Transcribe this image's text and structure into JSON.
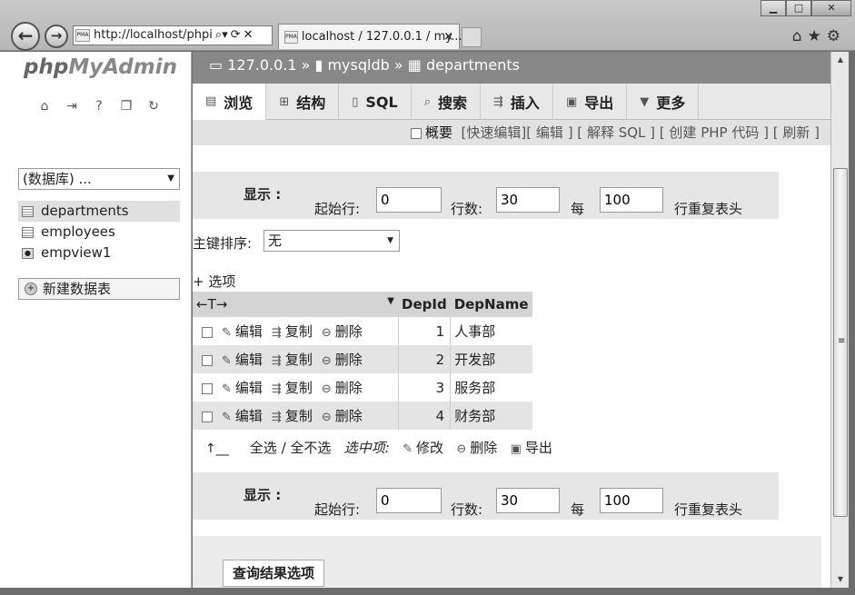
{
  "browser": {
    "address": "http://localhost/phpi",
    "tab_title": "localhost / 127.0.0.1 / my...",
    "tab_icon_label": "PMA",
    "tab_close": "×"
  },
  "sidebar": {
    "logo_php": "php",
    "logo_my": "MyAdmin",
    "db_select": "(数据库) ...",
    "tables": [
      {
        "label": "departments"
      },
      {
        "label": "employees"
      },
      {
        "label": "empview1"
      }
    ],
    "new_table": "新建数据表"
  },
  "breadcrumb": {
    "server": "127.0.0.1",
    "database": "mysqldb",
    "table": "departments",
    "sep": "»"
  },
  "tabs": [
    {
      "label": "浏览"
    },
    {
      "label": "结构"
    },
    {
      "label": "SQL"
    },
    {
      "label": "搜索"
    },
    {
      "label": "插入"
    },
    {
      "label": "导出"
    },
    {
      "label": "更多"
    }
  ],
  "links": {
    "profiling": "概要",
    "inline_edit": "快速编辑",
    "edit": "编辑",
    "explain": "解释 SQL",
    "create_php": "创建 PHP 代码",
    "refresh": "刷新"
  },
  "navigation": {
    "show_label": "显示 :",
    "start_row_label": "起始行:",
    "start_row": "0",
    "rows_label": "行数:",
    "rows": "30",
    "every_label": "每",
    "repeat": "100",
    "repeat_label": "行重复表头"
  },
  "sort": {
    "label": "主键排序:",
    "value": "无"
  },
  "options_label": "+ 选项",
  "table": {
    "arrows_header": "←T→",
    "columns": [
      "DepId",
      "DepName"
    ],
    "actions": {
      "edit": "编辑",
      "copy": "复制",
      "delete": "删除"
    },
    "rows": [
      {
        "id": "1",
        "name": "人事部"
      },
      {
        "id": "2",
        "name": "开发部"
      },
      {
        "id": "3",
        "name": "服务部"
      },
      {
        "id": "4",
        "name": "财务部"
      }
    ]
  },
  "bulk": {
    "check_all": "全选",
    "uncheck_all": "/ 全不选",
    "with_selected": "选中项:",
    "change": "修改",
    "delete": "删除",
    "export": "导出"
  },
  "query_results": {
    "legend": "查询结果选项"
  }
}
